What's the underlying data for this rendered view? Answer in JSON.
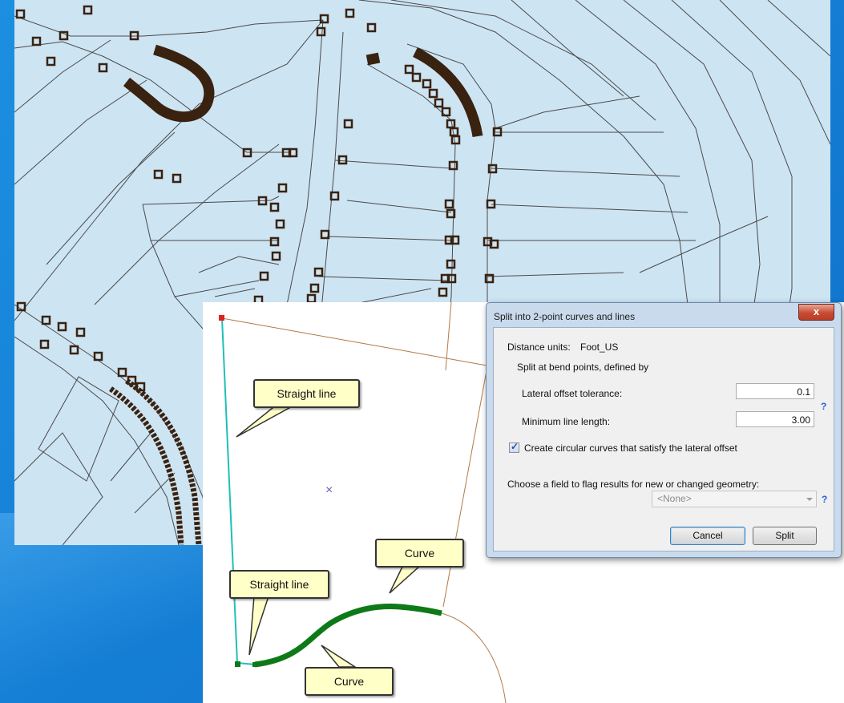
{
  "map": {
    "callouts": {
      "straight_line_top": "Straight line",
      "straight_line_bottom": "Straight line",
      "curve_top": "Curve",
      "curve_bottom": "Curve"
    },
    "center_marker": "×"
  },
  "dialog": {
    "title": "Split into 2-point curves and lines",
    "close_label": "x",
    "distance_units_label": "Distance units:",
    "distance_units_value": "Foot_US",
    "split_heading": "Split at bend points, defined by",
    "lateral_offset_label": "Lateral offset tolerance:",
    "lateral_offset_value": "0.1",
    "min_line_label": "Minimum line length:",
    "min_line_value": "3.00",
    "help_mark": "?",
    "circular_curves_label": "Create circular curves that satisfy the lateral offset",
    "circular_curves_checked": true,
    "check_mark": "✓",
    "flag_field_label": "Choose a field to flag results for new or changed geometry:",
    "flag_field_value": "<None>",
    "cancel_label": "Cancel",
    "split_label": "Split"
  },
  "colors": {
    "map_background": "#cde4f3",
    "parcel_line": "#4a4a4a",
    "vertex": "#3a2210",
    "straight_line": "#1fbfb8",
    "curve": "#0d7a17",
    "boundary": "#b07a45",
    "callout_fill": "#ffffc8"
  }
}
